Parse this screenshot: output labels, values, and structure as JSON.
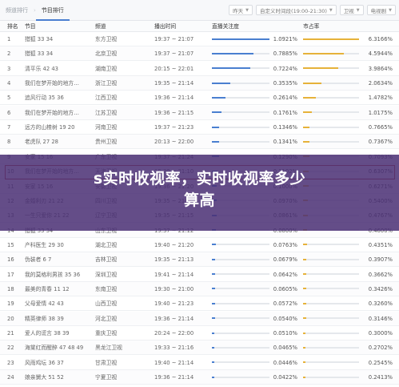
{
  "tabs": [
    {
      "label": "频道排行",
      "active": false
    },
    {
      "label": "节目排行",
      "active": true
    }
  ],
  "filters": [
    {
      "label": "昨天"
    },
    {
      "label": "自定义时间段(19:00-21:30)"
    },
    {
      "label": "卫视"
    },
    {
      "label": "电视剧"
    }
  ],
  "headers": {
    "rank": "排名",
    "program": "节目",
    "channel": "频道",
    "airtime": "播出时间",
    "live_attention": "直播关注度",
    "market_share": "市占率"
  },
  "rows": [
    {
      "rank": "1",
      "program": "猎狐 33 34",
      "channel": "东方卫视",
      "time": "19:37 ~ 21:07",
      "attention": "1.0921%",
      "share": "6.3166%",
      "att_frac": 1.0,
      "share_frac": 1.0
    },
    {
      "rank": "2",
      "program": "猎狐 33 34",
      "channel": "北京卫视",
      "time": "19:37 ~ 21:07",
      "attention": "0.7885%",
      "share": "4.5944%",
      "att_frac": 0.72,
      "share_frac": 0.73
    },
    {
      "rank": "3",
      "program": "清平乐 42 43",
      "channel": "湖南卫视",
      "time": "20:15 ~ 22:01",
      "attention": "0.7224%",
      "share": "3.9864%",
      "att_frac": 0.66,
      "share_frac": 0.63
    },
    {
      "rank": "4",
      "program": "我们在梦开始的地方…",
      "channel": "浙江卫视",
      "time": "19:35 ~ 21:14",
      "attention": "0.3535%",
      "share": "2.0634%",
      "att_frac": 0.32,
      "share_frac": 0.33
    },
    {
      "rank": "5",
      "program": "追风行动 35 36",
      "channel": "江西卫视",
      "time": "19:36 ~ 21:14",
      "attention": "0.2614%",
      "share": "1.4782%",
      "att_frac": 0.24,
      "share_frac": 0.23
    },
    {
      "rank": "6",
      "program": "我们在梦开始的地方…",
      "channel": "江苏卫视",
      "time": "19:36 ~ 21:15",
      "attention": "0.1761%",
      "share": "1.0175%",
      "att_frac": 0.16,
      "share_frac": 0.16
    },
    {
      "rank": "7",
      "program": "远方的山楂树 19 20",
      "channel": "河南卫视",
      "time": "19:37 ~ 21:23",
      "attention": "0.1346%",
      "share": "0.7665%",
      "att_frac": 0.12,
      "share_frac": 0.12
    },
    {
      "rank": "8",
      "program": "老虎队 27 28",
      "channel": "贵州卫视",
      "time": "20:13 ~ 22:00",
      "attention": "0.1341%",
      "share": "0.7367%",
      "att_frac": 0.12,
      "share_frac": 0.12
    },
    {
      "rank": "9",
      "program": "安家 15 16",
      "channel": "广东卫视",
      "time": "19:37 ~ 21:24",
      "attention": "0.1290%",
      "share": "0.7093%",
      "att_frac": 0.12,
      "share_frac": 0.11
    },
    {
      "rank": "10",
      "program": "我们在梦开始的地方…",
      "channel": "天津卫视",
      "time": "19:30 ~ 21:10",
      "attention": "0.1102%",
      "share": "0.6307%",
      "att_frac": 0.1,
      "share_frac": 0.1
    },
    {
      "rank": "11",
      "program": "安家 15 16",
      "channel": "安徽卫视",
      "time": "19:36 ~ 21:20",
      "attention": "0.1000%",
      "share": "0.6271%",
      "att_frac": 0.09,
      "share_frac": 0.1
    },
    {
      "rank": "12",
      "program": "金婚利刃 21 22",
      "channel": "四川卫视",
      "time": "19:35 ~ 21:10",
      "attention": "0.0970%",
      "share": "0.5400%",
      "att_frac": 0.09,
      "share_frac": 0.09
    },
    {
      "rank": "13",
      "program": "一生只爱你 21 22",
      "channel": "辽宁卫视",
      "time": "19:35 ~ 21:15",
      "attention": "0.0861%",
      "share": "0.4767%",
      "att_frac": 0.08,
      "share_frac": 0.08
    },
    {
      "rank": "14",
      "program": "猎狐 33 34",
      "channel": "山东卫视",
      "time": "19:37 ~ 21:12",
      "attention": "0.0800%",
      "share": "0.4600%",
      "att_frac": 0.07,
      "share_frac": 0.07
    },
    {
      "rank": "15",
      "program": "产科医生 29 30",
      "channel": "湖北卫视",
      "time": "19:40 ~ 21:20",
      "attention": "0.0763%",
      "share": "0.4351%",
      "att_frac": 0.07,
      "share_frac": 0.07
    },
    {
      "rank": "16",
      "program": "伪装者 6 7",
      "channel": "吉林卫视",
      "time": "19:35 ~ 21:13",
      "attention": "0.0679%",
      "share": "0.3907%",
      "att_frac": 0.06,
      "share_frac": 0.06
    },
    {
      "rank": "17",
      "program": "我的莫格利男孩 35 36",
      "channel": "深圳卫视",
      "time": "19:41 ~ 21:14",
      "attention": "0.0642%",
      "share": "0.3662%",
      "att_frac": 0.06,
      "share_frac": 0.06
    },
    {
      "rank": "18",
      "program": "最美的青春 11 12",
      "channel": "东南卫视",
      "time": "19:30 ~ 21:00",
      "attention": "0.0605%",
      "share": "0.3426%",
      "att_frac": 0.055,
      "share_frac": 0.054
    },
    {
      "rank": "19",
      "program": "父母爱情 42 43",
      "channel": "山西卫视",
      "time": "19:40 ~ 21:23",
      "attention": "0.0572%",
      "share": "0.3260%",
      "att_frac": 0.052,
      "share_frac": 0.052
    },
    {
      "rank": "20",
      "program": "精英律师 38 39",
      "channel": "河北卫视",
      "time": "19:36 ~ 21:14",
      "attention": "0.0540%",
      "share": "0.3146%",
      "att_frac": 0.05,
      "share_frac": 0.05
    },
    {
      "rank": "21",
      "program": "爱人的谎言 38 39",
      "channel": "重庆卫视",
      "time": "20:24 ~ 22:00",
      "attention": "0.0510%",
      "share": "0.3000%",
      "att_frac": 0.047,
      "share_frac": 0.047
    },
    {
      "rank": "22",
      "program": "海棠红而醒醉 47 48 49",
      "channel": "黑龙江卫视",
      "time": "19:33 ~ 21:16",
      "attention": "0.0465%",
      "share": "0.2702%",
      "att_frac": 0.043,
      "share_frac": 0.043
    },
    {
      "rank": "23",
      "program": "风雨鸡坛 36 37",
      "channel": "甘肃卫视",
      "time": "19:40 ~ 21:14",
      "attention": "0.0446%",
      "share": "0.2545%",
      "att_frac": 0.041,
      "share_frac": 0.04
    },
    {
      "rank": "24",
      "program": "娘亲舅大 51 52",
      "channel": "宁夏卫视",
      "time": "19:36 ~ 21:14",
      "attention": "0.0422%",
      "share": "0.2413%",
      "att_frac": 0.039,
      "share_frac": 0.038
    }
  ],
  "overlay": {
    "title_line1": "s实时收视率，实时收视率多少",
    "title_line2": "算高"
  },
  "colors": {
    "attention_bar": "#4a7fd0",
    "share_bar": "#e6b23a",
    "overlay": "#4a3074",
    "highlight": "#c0392b"
  }
}
